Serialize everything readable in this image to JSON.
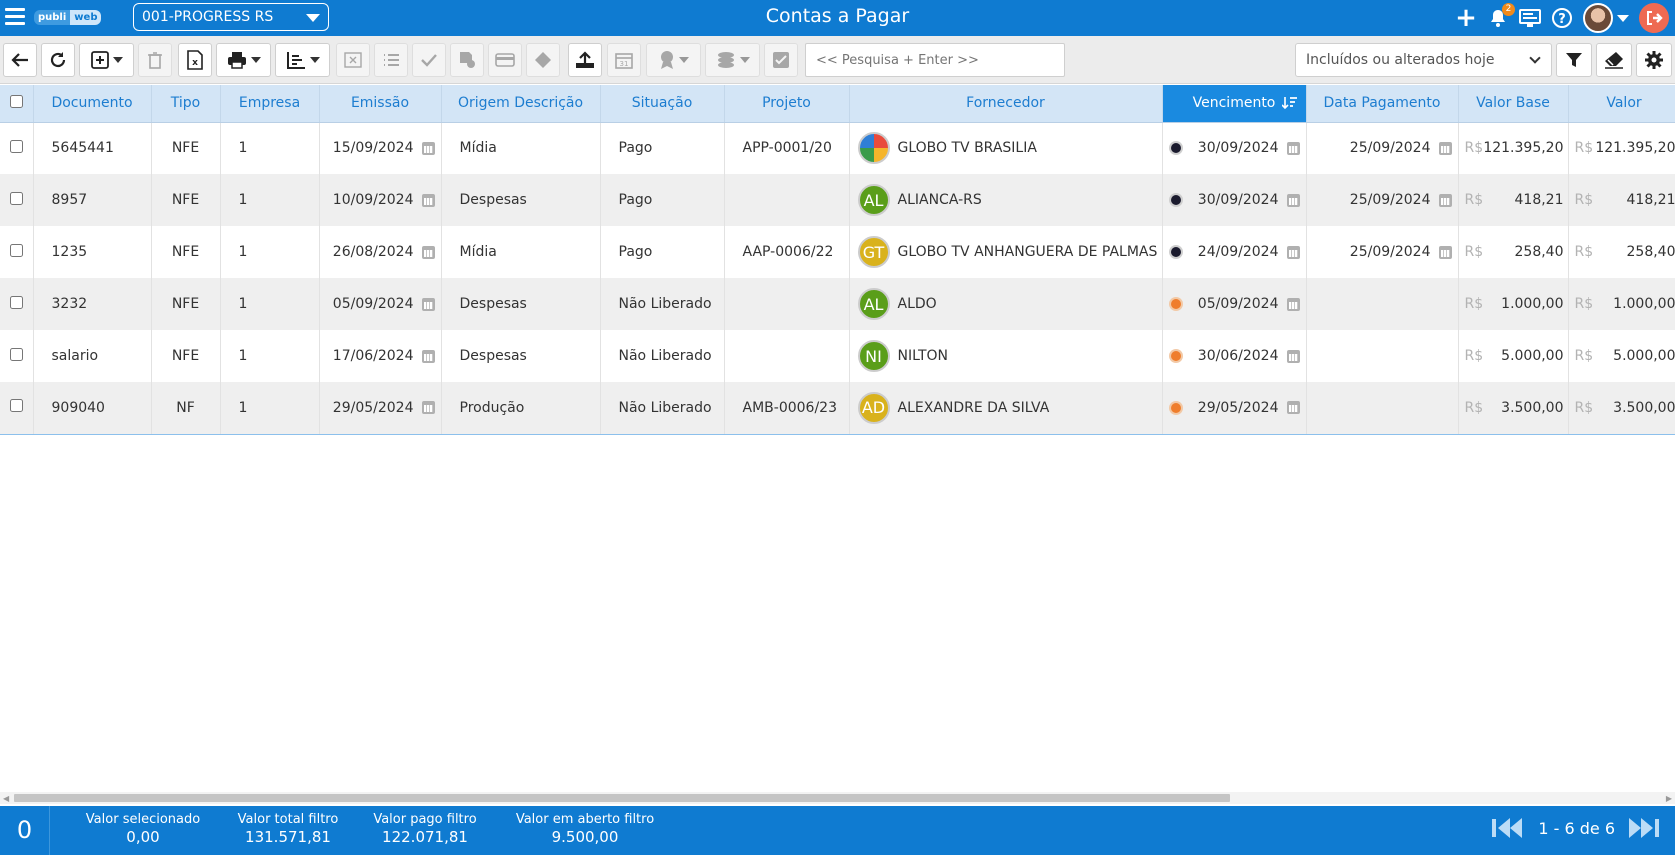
{
  "app": {
    "logo_left": "publi",
    "logo_right": "web",
    "company_select": "001-PROGRESS RS",
    "title": "Contas a Pagar",
    "notifications_count": "2"
  },
  "toolbar": {
    "search_placeholder": "<< Pesquisa + Enter >>",
    "filter_value": "Incluídos ou alterados hoje"
  },
  "grid": {
    "columns": [
      "Documento",
      "Tipo",
      "Empresa",
      "Emissão",
      "Origem Descrição",
      "Situação",
      "Projeto",
      "Fornecedor",
      "Vencimento",
      "Data Pagamento",
      "Valor Base",
      "Valor"
    ],
    "currency": "R$",
    "rows": [
      {
        "documento": "5645441",
        "tipo": "NFE",
        "empresa": "1",
        "emissao": "15/09/2024",
        "origem": "Mídia",
        "situacao": "Pago",
        "projeto": "APP-0001/20",
        "fornecedor": "GLOBO TV BRASILIA",
        "avatar": "",
        "avatar_color": "globo",
        "status": "paid",
        "vencimento": "30/09/2024",
        "data_pagamento": "25/09/2024",
        "valor_base": "121.395,20",
        "valor": "121.395,20"
      },
      {
        "documento": "8957",
        "tipo": "NFE",
        "empresa": "1",
        "emissao": "10/09/2024",
        "origem": "Despesas",
        "situacao": "Pago",
        "projeto": "",
        "fornecedor": "ALIANCA-RS",
        "avatar": "AL",
        "avatar_color": "#5a9e1a",
        "status": "paid",
        "vencimento": "30/09/2024",
        "data_pagamento": "25/09/2024",
        "valor_base": "418,21",
        "valor": "418,21"
      },
      {
        "documento": "1235",
        "tipo": "NFE",
        "empresa": "1",
        "emissao": "26/08/2024",
        "origem": "Mídia",
        "situacao": "Pago",
        "projeto": "AAP-0006/22",
        "fornecedor": "GLOBO TV ANHANGUERA DE PALMAS",
        "avatar": "GT",
        "avatar_color": "#d9b21c",
        "status": "paid",
        "vencimento": "24/09/2024",
        "data_pagamento": "25/09/2024",
        "valor_base": "258,40",
        "valor": "258,40"
      },
      {
        "documento": "3232",
        "tipo": "NFE",
        "empresa": "1",
        "emissao": "05/09/2024",
        "origem": "Despesas",
        "situacao": "Não Liberado",
        "projeto": "",
        "fornecedor": "ALDO",
        "avatar": "AL",
        "avatar_color": "#5a9e1a",
        "status": "open",
        "vencimento": "05/09/2024",
        "data_pagamento": "",
        "valor_base": "1.000,00",
        "valor": "1.000,00"
      },
      {
        "documento": "salario",
        "tipo": "NFE",
        "empresa": "1",
        "emissao": "17/06/2024",
        "origem": "Despesas",
        "situacao": "Não Liberado",
        "projeto": "",
        "fornecedor": "NILTON",
        "avatar": "NI",
        "avatar_color": "#5a9e1a",
        "status": "open",
        "vencimento": "30/06/2024",
        "data_pagamento": "",
        "valor_base": "5.000,00",
        "valor": "5.000,00"
      },
      {
        "documento": "909040",
        "tipo": "NF",
        "empresa": "1",
        "emissao": "29/05/2024",
        "origem": "Produção",
        "situacao": "Não Liberado",
        "projeto": "AMB-0006/23",
        "fornecedor": "ALEXANDRE DA SILVA",
        "avatar": "AD",
        "avatar_color": "#d9b21c",
        "status": "open",
        "vencimento": "29/05/2024",
        "data_pagamento": "",
        "valor_base": "3.500,00",
        "valor": "3.500,00"
      }
    ]
  },
  "footer": {
    "selected_count": "0",
    "stats": [
      {
        "label": "Valor selecionado",
        "value": "0,00"
      },
      {
        "label": "Valor total filtro",
        "value": "131.571,81"
      },
      {
        "label": "Valor pago filtro",
        "value": "122.071,81"
      },
      {
        "label": "Valor em aberto filtro",
        "value": "9.500,00"
      }
    ],
    "pagination": "1 - 6 de 6"
  },
  "colors": {
    "primary": "#0f7bd1",
    "header_bg": "#d3e5f6",
    "sorted_header": "#1a8ae0",
    "paid_dot": "#1b1b2e",
    "open_dot": "#ef7d2c"
  }
}
